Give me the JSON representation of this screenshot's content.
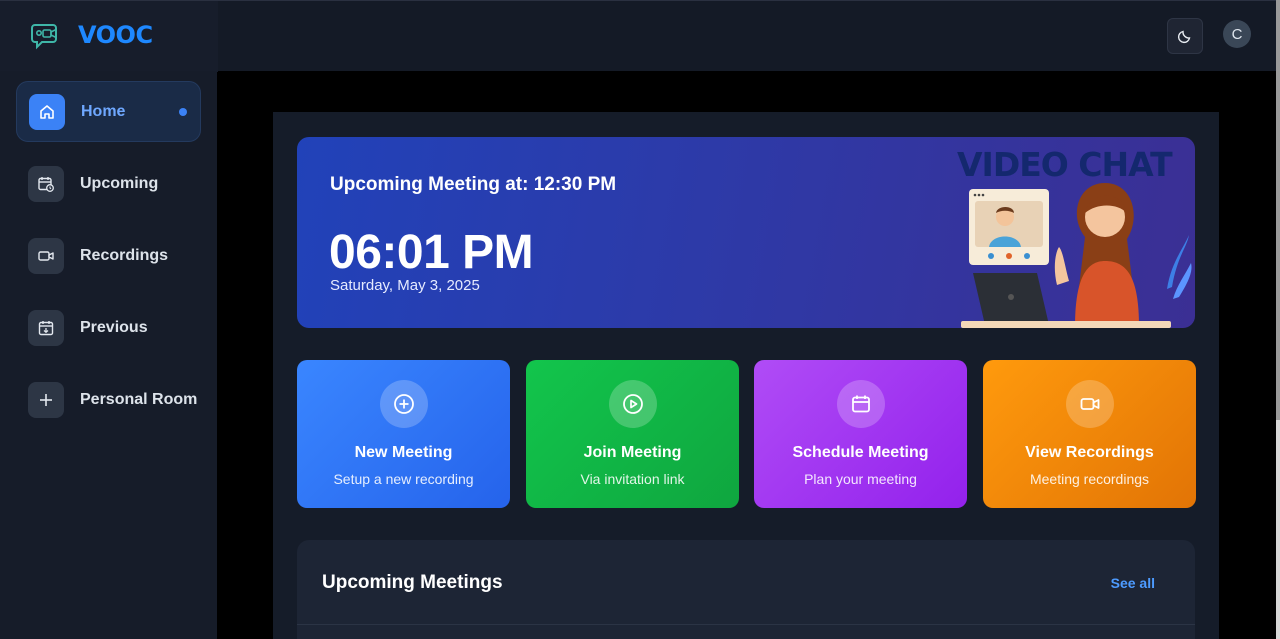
{
  "app": {
    "name": "VOOC",
    "user_initial": "C"
  },
  "sidebar": {
    "items": [
      {
        "label": "Home",
        "icon": "home-icon",
        "active": true
      },
      {
        "label": "Upcoming",
        "icon": "calendar-clock-icon",
        "active": false
      },
      {
        "label": "Recordings",
        "icon": "video-icon",
        "active": false
      },
      {
        "label": "Previous",
        "icon": "calendar-check-icon",
        "active": false
      },
      {
        "label": "Personal Room",
        "icon": "plus-icon",
        "active": false
      }
    ]
  },
  "hero": {
    "upcoming_label": "Upcoming Meeting at: 12:30 PM",
    "time": "06:01 PM",
    "date": "Saturday, May 3, 2025",
    "art_title": "VIDEO CHAT"
  },
  "actions": [
    {
      "title": "New Meeting",
      "subtitle": "Setup a new recording",
      "icon": "plus-circle-icon",
      "color": "#2f7cf6"
    },
    {
      "title": "Join Meeting",
      "subtitle": "Via invitation link",
      "icon": "play-circle-icon",
      "color": "#12b84a"
    },
    {
      "title": "Schedule Meeting",
      "subtitle": "Plan your meeting",
      "icon": "calendar-icon",
      "color": "#a13cf2"
    },
    {
      "title": "View Recordings",
      "subtitle": "Meeting recordings",
      "icon": "video-icon",
      "color": "#f18a0c"
    }
  ],
  "upcoming_section": {
    "title": "Upcoming Meetings",
    "see_all": "See all"
  },
  "colors": {
    "accent": "#3b82f6",
    "brand": "#1e88ff",
    "background": "#000000",
    "panel": "#151c29"
  }
}
